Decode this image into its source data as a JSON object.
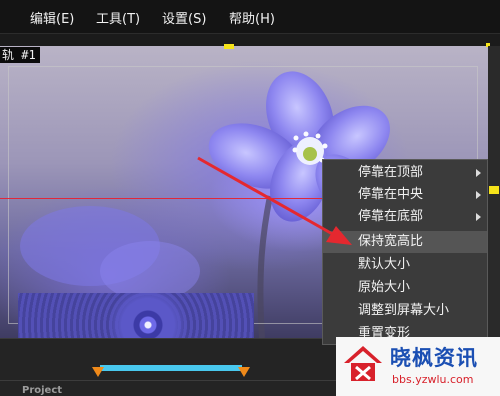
{
  "menubar": {
    "items": [
      {
        "label": "编辑(E)"
      },
      {
        "label": "工具(T)"
      },
      {
        "label": "设置(S)"
      },
      {
        "label": "帮助(H)"
      }
    ]
  },
  "preview": {
    "track_label": "轨 #1"
  },
  "context_menu": {
    "items": [
      {
        "label": "停靠在顶部",
        "submenu": true
      },
      {
        "label": "停靠在中央",
        "submenu": true
      },
      {
        "label": "停靠在底部",
        "submenu": true
      },
      {
        "label": "保持宽高比",
        "highlighted": true
      },
      {
        "label": "默认大小"
      },
      {
        "label": "原始大小"
      },
      {
        "label": "调整到屏幕大小"
      },
      {
        "label": "重置变形"
      }
    ]
  },
  "timeline": {
    "project_label": "Project"
  },
  "watermark": {
    "title": "晓枫资讯",
    "url": "bbs.yzwlu.com"
  },
  "colors": {
    "accent_yellow": "#f5e31a",
    "guide_red": "#e0283a",
    "timeline_blue": "#49c8ee",
    "marker_orange": "#f08a1a",
    "menu_bg": "#3b3b3b",
    "menu_highlight": "#555555"
  }
}
